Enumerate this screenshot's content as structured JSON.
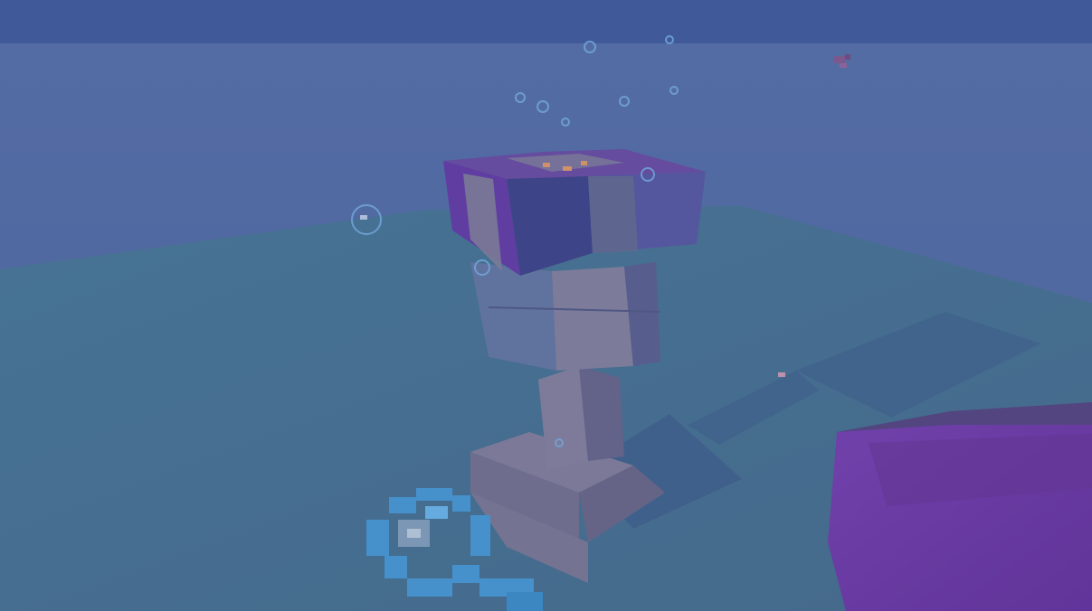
{
  "scene": {
    "type": "underwater-voxel-game-view",
    "colors": {
      "surface": "#435c9a",
      "water": "#5b73a8",
      "seafloor": "#4a7491",
      "shadow": "#3f5c86",
      "coral_purple": "#6b3e9a",
      "coral_dark": "#3d3f82",
      "sand_block": "#857f93",
      "sand_block_light": "#9a93a3",
      "conduit_purple": "#7a3ca8",
      "bubble": "#7fb9e8",
      "particle": "#f0a060"
    },
    "icons": [
      "bubble-icon",
      "held-item-icon",
      "fish-icon"
    ]
  }
}
